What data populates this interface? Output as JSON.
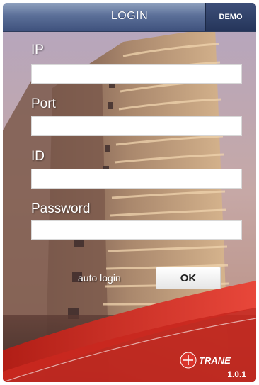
{
  "header": {
    "title": "LOGIN",
    "demo_label": "DEMO"
  },
  "form": {
    "ip_label": "IP",
    "port_label": "Port",
    "id_label": "ID",
    "password_label": "Password",
    "ip_value": "",
    "port_value": "",
    "id_value": "",
    "password_value": "",
    "auto_login_label": "auto login",
    "auto_login_checked": false,
    "ok_label": "OK"
  },
  "footer": {
    "brand": "TRANE",
    "version": "1.0.1"
  },
  "colors": {
    "header": "#4a5d87",
    "brand_red": "#d9332b",
    "field_bg": "#ffffff"
  }
}
